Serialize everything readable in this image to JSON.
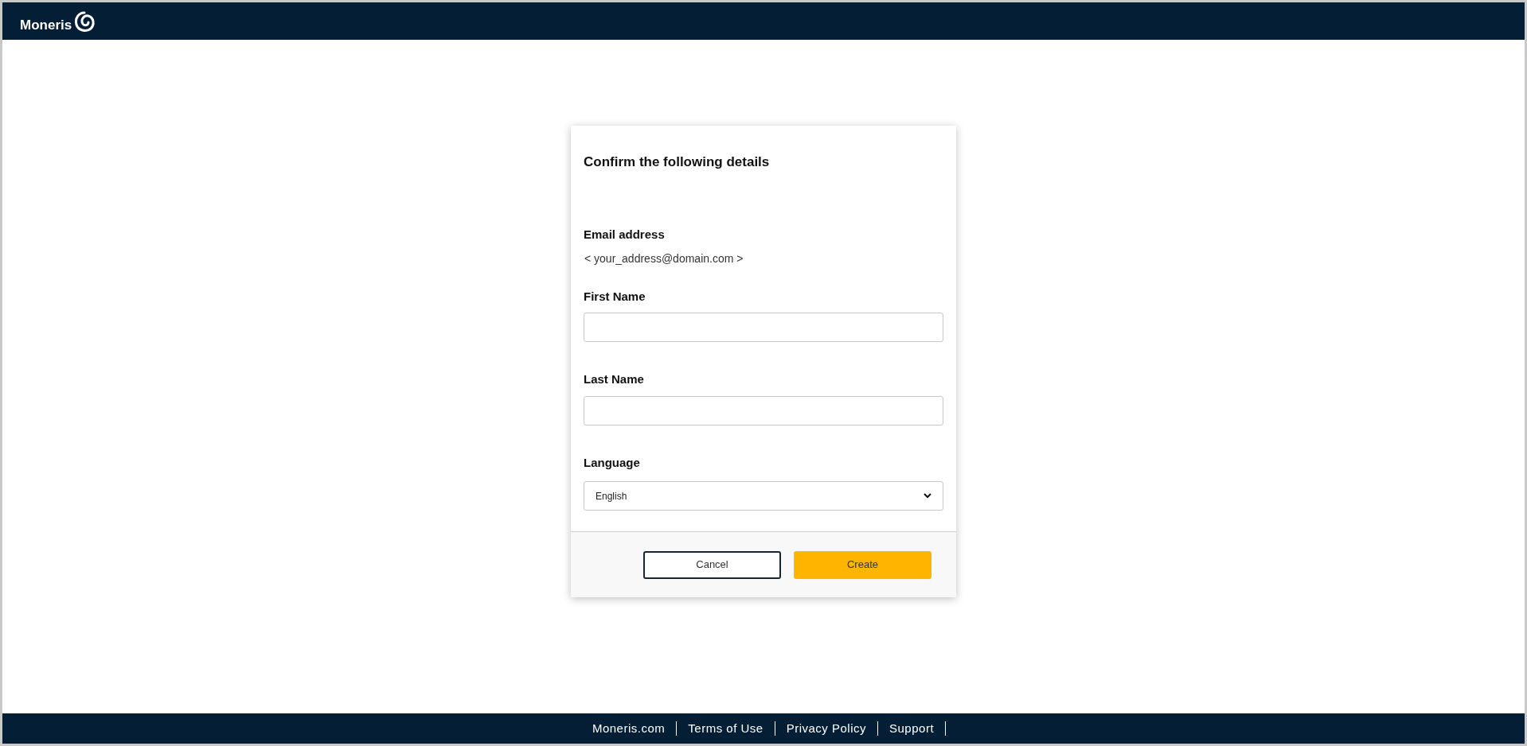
{
  "header": {
    "logo": "Moneris"
  },
  "dialog": {
    "title": "Confirm the following details",
    "email": {
      "label": "Email address",
      "value": "< your_address@domain.com >"
    },
    "fields": [
      {
        "label": "First Name"
      },
      {
        "label": "Last Name"
      }
    ],
    "language": {
      "label": "Language",
      "value": "English"
    },
    "buttons": [
      {
        "label": "Cancel",
        "kind": "secondary"
      },
      {
        "label": "Create",
        "kind": "primary"
      }
    ]
  },
  "footer": {
    "links": [
      "Moneris.com",
      "Terms of Use",
      "Privacy Policy",
      "Support"
    ]
  }
}
